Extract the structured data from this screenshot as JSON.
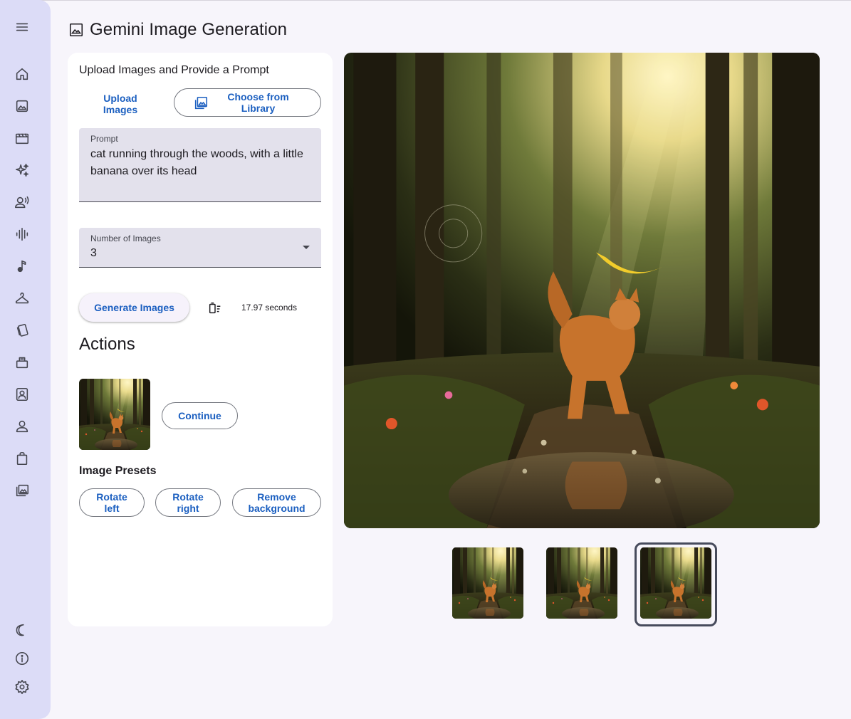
{
  "app": {
    "title": "Gemini Image Generation"
  },
  "sidebar": {
    "items": [
      {
        "icon": "menu-icon"
      },
      {
        "icon": "home-icon"
      },
      {
        "icon": "image-icon"
      },
      {
        "icon": "movie-icon"
      },
      {
        "icon": "sparkle-icon"
      },
      {
        "icon": "voice-icon"
      },
      {
        "icon": "audio-wave-icon"
      },
      {
        "icon": "music-note-icon"
      },
      {
        "icon": "hanger-icon"
      },
      {
        "icon": "cards-icon"
      },
      {
        "icon": "storyboard-icon"
      },
      {
        "icon": "portrait-icon"
      },
      {
        "icon": "person-icon"
      },
      {
        "icon": "shopping-bag-icon"
      },
      {
        "icon": "photo-library-icon"
      }
    ],
    "bottom_items": [
      {
        "icon": "dark-mode-icon"
      },
      {
        "icon": "info-icon"
      },
      {
        "icon": "settings-icon"
      }
    ]
  },
  "panel": {
    "heading": "Upload Images and Provide a Prompt",
    "upload_label": "Upload Images",
    "library_label": "Choose from Library",
    "prompt": {
      "label": "Prompt",
      "value": "cat running through the woods, with a little banana over its head"
    },
    "num_images": {
      "label": "Number of Images",
      "value": "3"
    },
    "generate_label": "Generate Images",
    "elapsed": "17.97 seconds",
    "actions_title": "Actions",
    "continue_label": "Continue",
    "presets_title": "Image Presets",
    "presets": [
      "Rotate left",
      "Rotate right",
      "Remove background"
    ]
  },
  "gallery": {
    "thumbnail_count": 3,
    "selected_index": 2
  },
  "colors": {
    "sidebar_bg": "#dcdcf7",
    "accent": "#1b5fc0",
    "field_bg": "#e3e1ec",
    "page_bg": "#f7f5fb"
  }
}
